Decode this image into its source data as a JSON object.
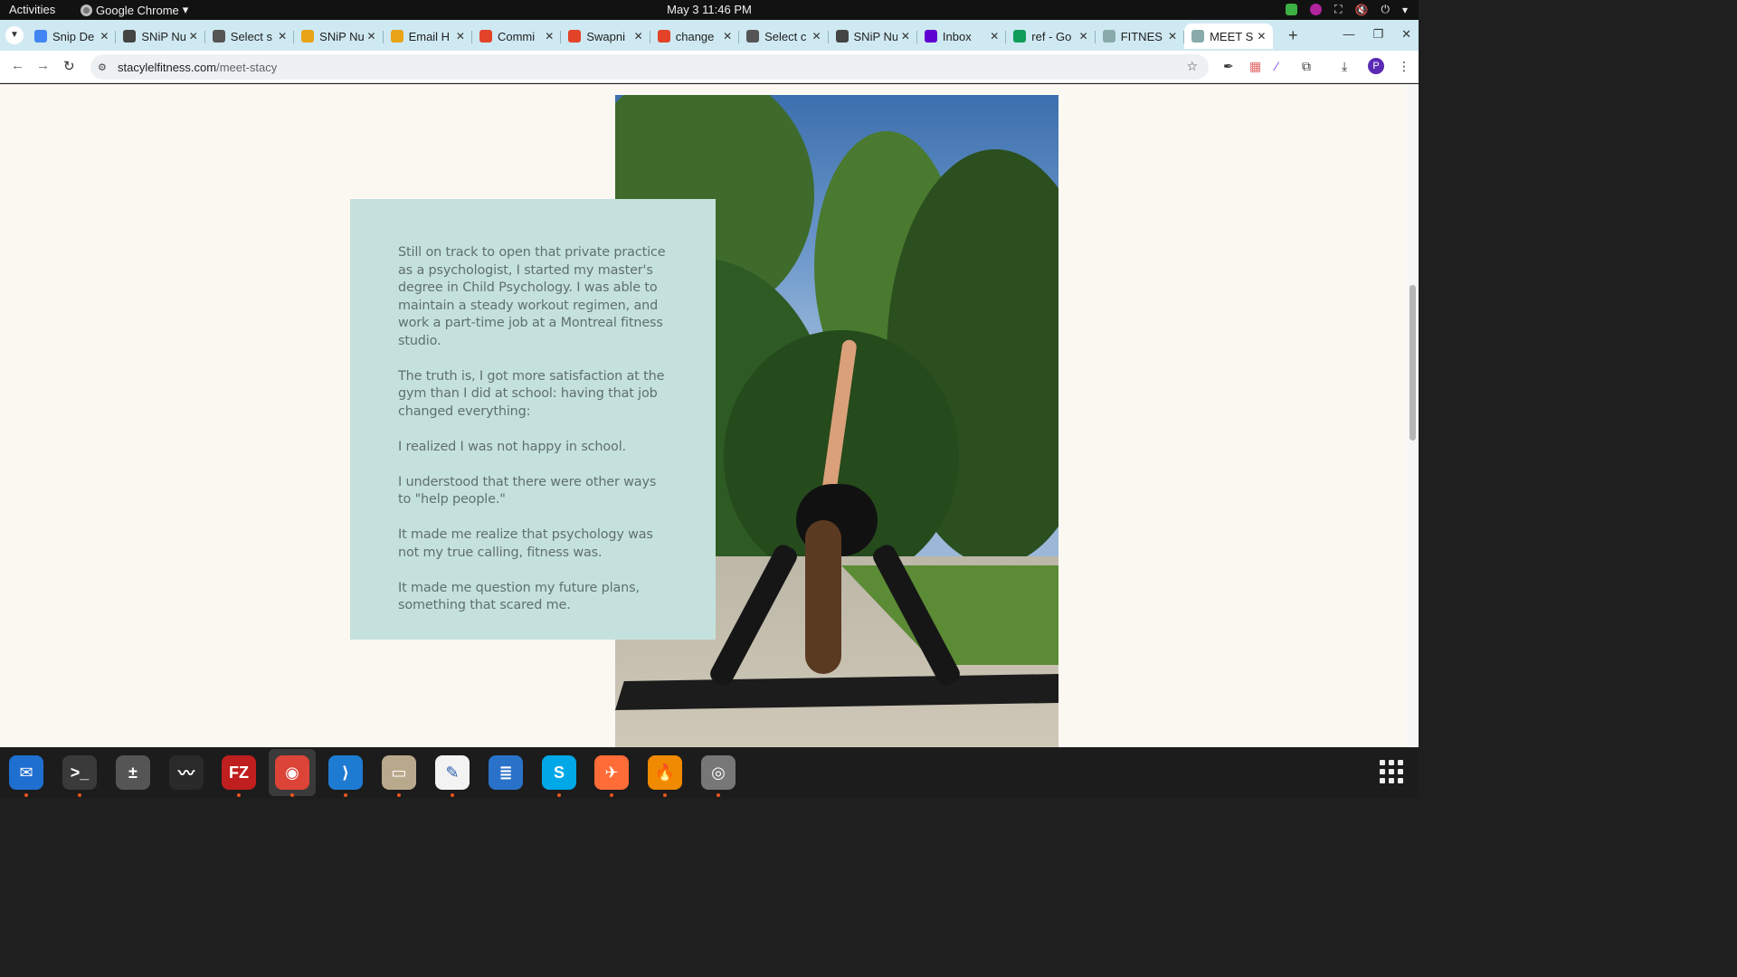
{
  "topbar": {
    "activities": "Activities",
    "app_name": "Google Chrome",
    "clock": "May 3  11:46 PM"
  },
  "tabs": [
    {
      "title": "Snip De",
      "favicon": "google-docs-icon",
      "color": "#4285f4"
    },
    {
      "title": "SNiP Nu",
      "favicon": "snip-icon",
      "color": "#444444"
    },
    {
      "title": "Select s",
      "favicon": "globe-icon",
      "color": "#555555"
    },
    {
      "title": "SNiP Nu",
      "favicon": "chrome-color-icon",
      "color": "#e8a317"
    },
    {
      "title": "Email H",
      "favicon": "chrome-color-icon",
      "color": "#e8a317"
    },
    {
      "title": "Commi",
      "favicon": "gitlab-icon",
      "color": "#e24329"
    },
    {
      "title": "Swapni",
      "favicon": "gitlab-icon",
      "color": "#e24329"
    },
    {
      "title": "change",
      "favicon": "gitlab-icon",
      "color": "#e24329"
    },
    {
      "title": "Select c",
      "favicon": "globe-icon",
      "color": "#555555"
    },
    {
      "title": "SNiP Nu",
      "favicon": "snip-icon",
      "color": "#444444"
    },
    {
      "title": "Inbox",
      "favicon": "yahoo-icon",
      "color": "#5f01d1"
    },
    {
      "title": "ref - Go",
      "favicon": "google-sheets-icon",
      "color": "#0f9d58"
    },
    {
      "title": "FITNES",
      "favicon": "site-icon",
      "color": "#8aa"
    },
    {
      "title": "MEET S",
      "favicon": "site-icon",
      "color": "#8aa",
      "active": true
    }
  ],
  "address": {
    "domain": "stacylelfitness.com",
    "path": "/meet-stacy"
  },
  "profile_initial": "P",
  "content": {
    "paragraphs": [
      "Still on track to open that private practice as a psychologist, I started my master's degree in Child Psychology. I was able to maintain a steady workout regimen, and work a part-time job at a Montreal fitness studio.",
      "The truth is, I got more satisfaction at the gym than I did at school: having that job changed everything:",
      "I realized I was not happy in school.",
      "I understood that there were other ways to \"help people.\"",
      "It made me realize that psychology was not my true calling, fitness was.",
      "It made me question my future plans, something that scared me."
    ]
  },
  "dock": [
    {
      "name": "thunderbird-icon",
      "glyph": "✉",
      "color": "#1f6fd1",
      "running": true
    },
    {
      "name": "terminal-icon",
      "glyph": ">_",
      "color": "#3a3a3a",
      "running": true
    },
    {
      "name": "calculator-icon",
      "glyph": "±",
      "color": "#555555",
      "running": false
    },
    {
      "name": "system-monitor-icon",
      "glyph": "〰",
      "color": "#2a2a2a",
      "running": false
    },
    {
      "name": "filezilla-icon",
      "glyph": "FZ",
      "color": "#bf1f1f",
      "running": true
    },
    {
      "name": "chrome-icon",
      "glyph": "◉",
      "color": "#db4437",
      "running": true
    },
    {
      "name": "vscode-icon",
      "glyph": "⟩",
      "color": "#1e7bd2",
      "running": true
    },
    {
      "name": "files-icon",
      "glyph": "▭",
      "color": "#b9a98c",
      "running": true
    },
    {
      "name": "text-editor-icon",
      "glyph": "✎",
      "color": "#f3f3f3",
      "running": true
    },
    {
      "name": "libreoffice-writer-icon",
      "glyph": "≣",
      "color": "#2a72c9",
      "running": false
    },
    {
      "name": "skype-icon",
      "glyph": "S",
      "color": "#00a8e8",
      "running": true
    },
    {
      "name": "postman-icon",
      "glyph": "✈",
      "color": "#ff6c37",
      "running": true
    },
    {
      "name": "hotspot-icon",
      "glyph": "🔥",
      "color": "#f08a00",
      "running": true
    },
    {
      "name": "disc-icon",
      "glyph": "◎",
      "color": "#777777",
      "running": true
    }
  ]
}
